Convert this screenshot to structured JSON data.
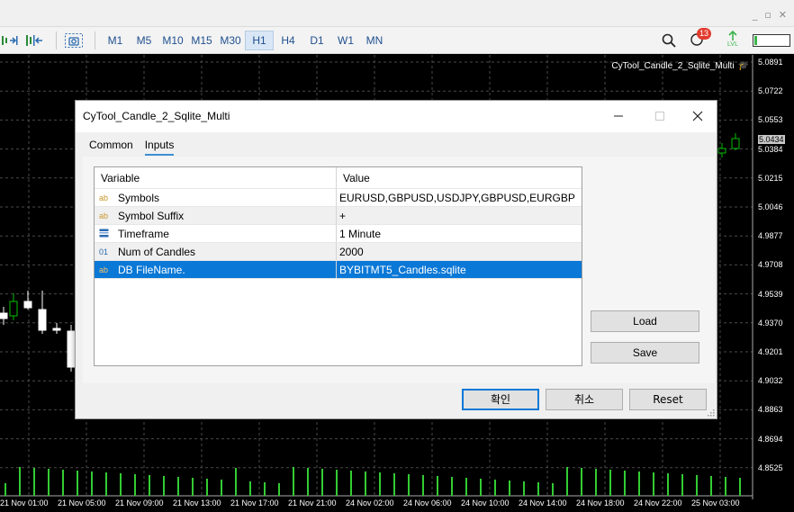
{
  "toolbar": {
    "timeframes": [
      "M1",
      "M5",
      "M10",
      "M15",
      "M30",
      "H1",
      "H4",
      "D1",
      "W1",
      "MN"
    ],
    "active_timeframe": "H1",
    "notification_count": "13",
    "lvl_label": "LVL"
  },
  "window_controls": [
    "_",
    "▫",
    "✕"
  ],
  "chart": {
    "name": "CyTool_Candle_2_Sqlite_Multi",
    "prices": [
      "5.0891",
      "5.0722",
      "5.0553",
      "5.0384",
      "5.0215",
      "5.0046",
      "4.9877",
      "4.9708",
      "4.9539",
      "4.9370",
      "4.9201",
      "4.9032",
      "4.8863",
      "4.8694",
      "4.8525"
    ],
    "current_price": "5.0434",
    "times": [
      "21 Nov 01:00",
      "21 Nov 05:00",
      "21 Nov 09:00",
      "21 Nov 13:00",
      "21 Nov 17:00",
      "21 Nov 21:00",
      "24 Nov 02:00",
      "24 Nov 06:00",
      "24 Nov 10:00",
      "24 Nov 14:00",
      "24 Nov 18:00",
      "24 Nov 22:00",
      "25 Nov 03:00"
    ],
    "colors": {
      "background": "#000000",
      "grid": "#4a4a4a",
      "bull": "#00c000",
      "volume": "#33cc33",
      "candle_body": "#ffffff"
    }
  },
  "dialog": {
    "title": "CyTool_Candle_2_Sqlite_Multi",
    "tabs": [
      "Common",
      "Inputs"
    ],
    "active_tab": "Inputs",
    "headers": {
      "variable": "Variable",
      "value": "Value"
    },
    "rows": [
      {
        "icon": "ab",
        "variable": "Symbols",
        "value": "EURUSD,GBPUSD,USDJPY,GBPUSD,EURGBP"
      },
      {
        "icon": "ab",
        "variable": "Symbol Suffix",
        "value": "+"
      },
      {
        "icon": "enum",
        "variable": "Timeframe",
        "value": "1 Minute"
      },
      {
        "icon": "01",
        "variable": "Num of Candles",
        "value": "2000"
      },
      {
        "icon": "ab",
        "variable": "DB FileName.",
        "value": "BYBITMT5_Candles.sqlite"
      }
    ],
    "selected_row": 4,
    "buttons": {
      "load": "Load",
      "save": "Save",
      "ok": "확인",
      "cancel": "취소",
      "reset": "Reset"
    },
    "colors": {
      "selection": "#0a78d7",
      "tab_underline": "#3b8fd4"
    }
  }
}
